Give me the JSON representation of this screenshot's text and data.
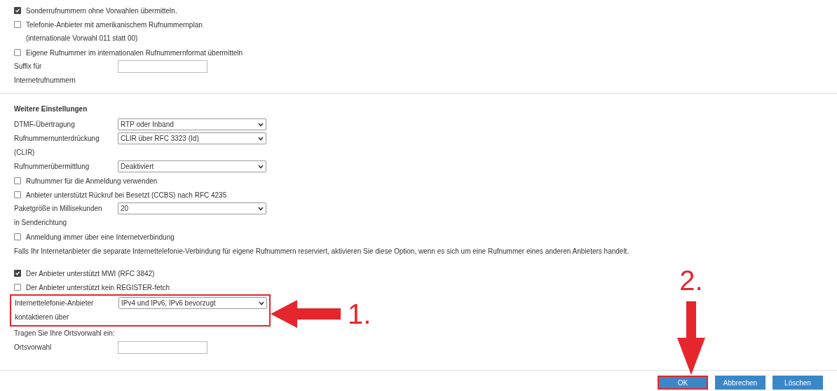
{
  "rows": [
    {
      "kind": "checkbox",
      "label": "Sonderrufnummern ohne Vorwahlen übermitteln.",
      "checked": true
    },
    {
      "kind": "checkbox",
      "label": "Telefonie-Anbieter mit amerikanischem Rufnummernplan",
      "sublabel": "(internationale Vorwahl 011 statt 00)",
      "checked": false
    },
    {
      "kind": "checkbox",
      "label": "Eigene Rufnummer im internationalen Rufnummernformat übermitteln",
      "checked": false
    },
    {
      "kind": "input",
      "label": [
        "Suffix für",
        "Internetrufnummern"
      ]
    },
    {
      "kind": "divider"
    },
    {
      "kind": "heading",
      "label": "Weitere Einstellungen"
    },
    {
      "kind": "select",
      "label": [
        "DTMF-Übertragung"
      ],
      "value": "RTP oder Inband"
    },
    {
      "kind": "select",
      "label": [
        "Rufnummernunterdrückung",
        "(CLIR)"
      ],
      "value": "CLIR über RFC 3323 (Id)"
    },
    {
      "kind": "select",
      "label": [
        "Rufnummerübermittlung"
      ],
      "value": "Deaktiviert"
    },
    {
      "kind": "checkbox",
      "label": "Rufnummer für die Anmeldung verwenden",
      "checked": false
    },
    {
      "kind": "checkbox",
      "label": "Anbieter unterstützt Rückruf bei Besetzt (CCBS) nach RFC 4235",
      "checked": false
    },
    {
      "kind": "select",
      "label": [
        "Paketgröße in Millisekunden",
        "in Senderichtung"
      ],
      "value": "20"
    },
    {
      "kind": "checkbox",
      "label": "Anmeldung immer über eine Internetverbindung",
      "checked": false
    },
    {
      "kind": "note",
      "label": "Falls Ihr Internetanbieter die separate Internettelefonie-Verbindung für eigene Rufnummern reserviert, aktivieren Sie diese Option, wenn es sich um eine Rufnummer eines anderen Anbieters handelt."
    },
    {
      "kind": "checkbox",
      "label": "Der Anbieter unterstützt MWI (RFC 3842)",
      "checked": true
    },
    {
      "kind": "checkbox",
      "label": "Der Anbieter unterstützt kein REGISTER-fetch",
      "checked": false
    },
    {
      "kind": "select",
      "label": [
        "Internettelefonie-Anbieter",
        "kontaktieren über"
      ],
      "value": "IPv4 und IPv6, IPv6 bevorzugt",
      "highlighted": true
    },
    {
      "kind": "text",
      "label": "Tragen Sie Ihre Ortsvorwahl ein:"
    },
    {
      "kind": "input",
      "label": [
        "Ortsvorwahl"
      ]
    }
  ],
  "buttons": [
    {
      "label": "OK",
      "highlighted": true
    },
    {
      "label": "Abbrechen",
      "highlighted": false
    },
    {
      "label": "Löschen",
      "highlighted": false
    }
  ],
  "annotations": [
    {
      "label": "1.",
      "kind": "left"
    },
    {
      "label": "2.",
      "kind": "down"
    }
  ]
}
